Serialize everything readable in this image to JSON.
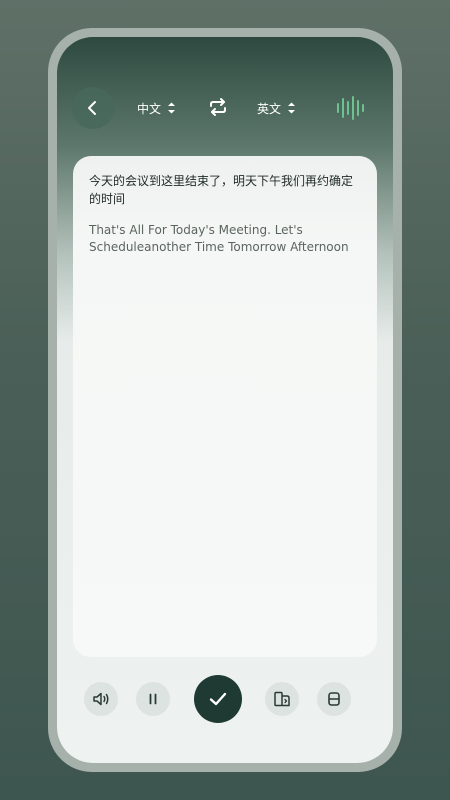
{
  "header": {
    "source_language": "中文",
    "target_language": "英文"
  },
  "icons": {
    "back": "chevron-left-icon",
    "source_dropdown": "up-down-arrows-icon",
    "swap": "swap-icon",
    "target_dropdown": "up-down-arrows-icon",
    "voice": "sound-wave-icon",
    "speaker": "speaker-icon",
    "pause": "pause-icon",
    "confirm": "check-icon",
    "layout": "page-layout-icon",
    "split": "split-view-icon"
  },
  "translation": {
    "source_text": "今天的会议到这里结束了，明天下午我们再约确定的时间",
    "target_text": "That's All For Today's Meeting. Let's Scheduleanother Time Tomorrow Afternoon"
  },
  "colors": {
    "accent": "#1f3a33",
    "wave": "#6fc28f"
  }
}
